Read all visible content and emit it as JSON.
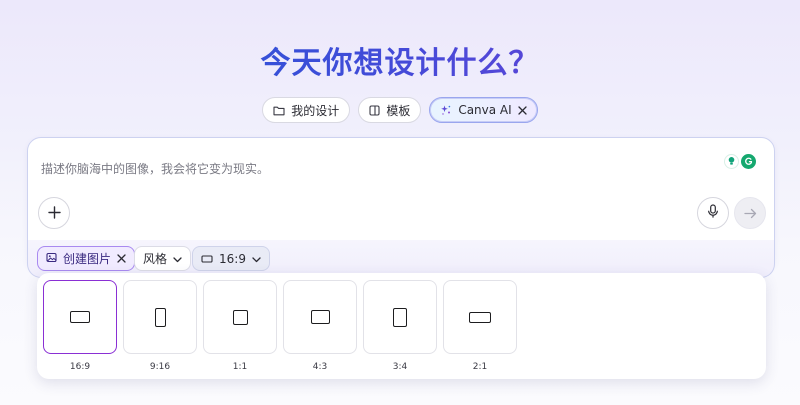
{
  "headline": "今天你想设计什么？",
  "mode_tabs": [
    {
      "label": "我的设计",
      "icon": "folder-icon"
    },
    {
      "label": "模板",
      "icon": "template-icon"
    },
    {
      "label": "Canva AI",
      "icon": "sparkle-icon",
      "active": true
    }
  ],
  "prompt": {
    "placeholder": "描述你脑海中的图像，我会将它变为现实。"
  },
  "options": {
    "create_label": "创建图片",
    "style_label": "风格",
    "ratio_label": "16:9"
  },
  "ratio_options": [
    {
      "label": "16:9",
      "selected": true
    },
    {
      "label": "9:16"
    },
    {
      "label": "1:1"
    },
    {
      "label": "4:3"
    },
    {
      "label": "3:4"
    },
    {
      "label": "2:1"
    }
  ],
  "colors": {
    "accent_purple": "#8a2fd4",
    "headline_start": "#1e5bd8",
    "headline_end": "#7a3ed6"
  }
}
